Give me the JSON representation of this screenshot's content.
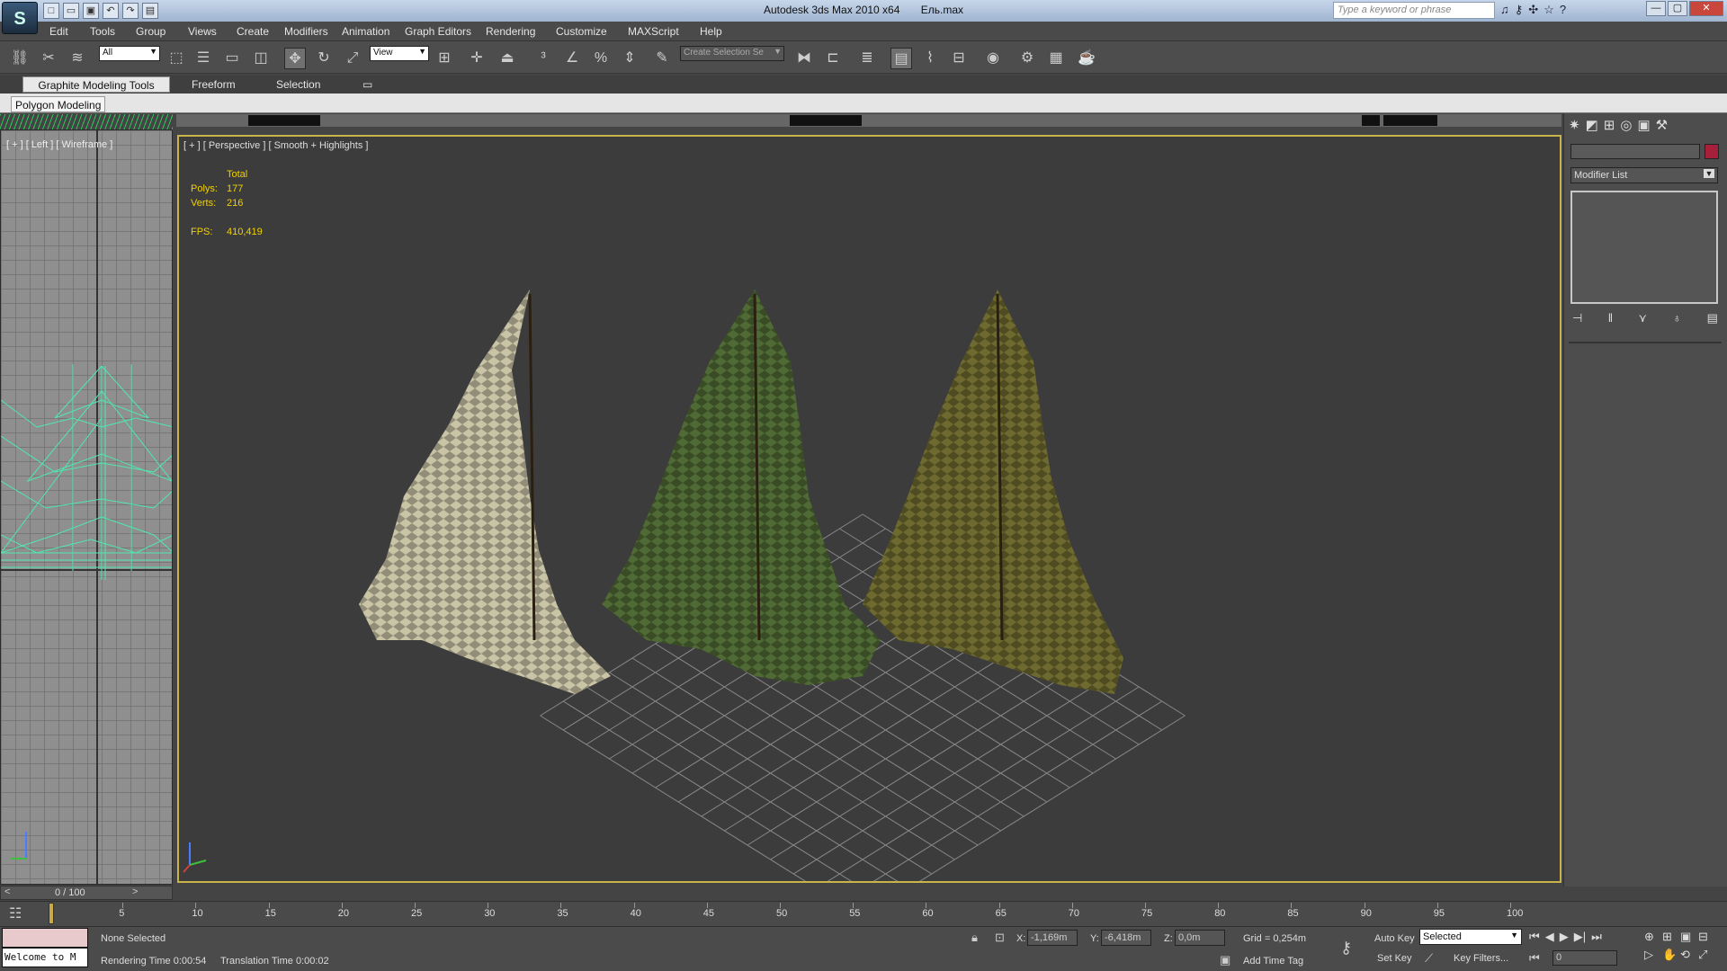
{
  "app": {
    "title": "Autodesk 3ds Max  2010 x64",
    "file": "Ель.max",
    "logo": "S",
    "search_placeholder": "Type a keyword or phrase"
  },
  "menu": [
    "Edit",
    "Tools",
    "Group",
    "Views",
    "Create",
    "Modifiers",
    "Animation",
    "Graph Editors",
    "Rendering",
    "Customize",
    "MAXScript",
    "Help"
  ],
  "toolbar": {
    "filter_value": "All",
    "coord_system_value": "View",
    "selection_set_placeholder": "Create Selection Se"
  },
  "ribbon": {
    "tabs": [
      "Graphite Modeling Tools",
      "Freeform",
      "Selection"
    ],
    "active_panel": "Polygon Modeling"
  },
  "left_viewport": {
    "label": "[ + ] [ Left ] [ Wireframe ]",
    "frame_counter": "0 / 100"
  },
  "main_viewport": {
    "label": "[ + ] [ Perspective ] [ Smooth + Highlights ]",
    "stats": {
      "header": "Total",
      "polys_label": "Polys:",
      "polys_value": "177",
      "verts_label": "Verts:",
      "verts_value": "216",
      "fps_label": "FPS:",
      "fps_value": "410,419"
    },
    "trees": [
      {
        "name": "snowy-fir",
        "color": "#c9c4a6"
      },
      {
        "name": "green-fir",
        "color": "#4f6a34"
      },
      {
        "name": "olive-fir",
        "color": "#6e6a2f"
      }
    ],
    "highlight_color": "#c9b44a"
  },
  "command_panel": {
    "modifier_list_label": "Modifier List",
    "object_color": "#a61f3b"
  },
  "timeline": {
    "ticks": [
      "5",
      "10",
      "15",
      "20",
      "25",
      "30",
      "35",
      "40",
      "45",
      "50",
      "55",
      "60",
      "65",
      "70",
      "75",
      "80",
      "85",
      "90",
      "95",
      "100"
    ]
  },
  "status": {
    "selection": "None Selected",
    "rendering_time": "Rendering Time  0:00:54",
    "translation_time": "Translation Time  0:00:02",
    "listener": "Welcome to M",
    "x_label": "X:",
    "x_value": "-1,169m",
    "y_label": "Y:",
    "y_value": "-6,418m",
    "z_label": "Z:",
    "z_value": "0,0m",
    "grid": "Grid = 0,254m",
    "add_time_tag": "Add Time Tag",
    "auto_key": "Auto Key",
    "set_key": "Set Key",
    "key_mode": "Selected",
    "key_filters": "Key Filters...",
    "frame_value": "0"
  }
}
